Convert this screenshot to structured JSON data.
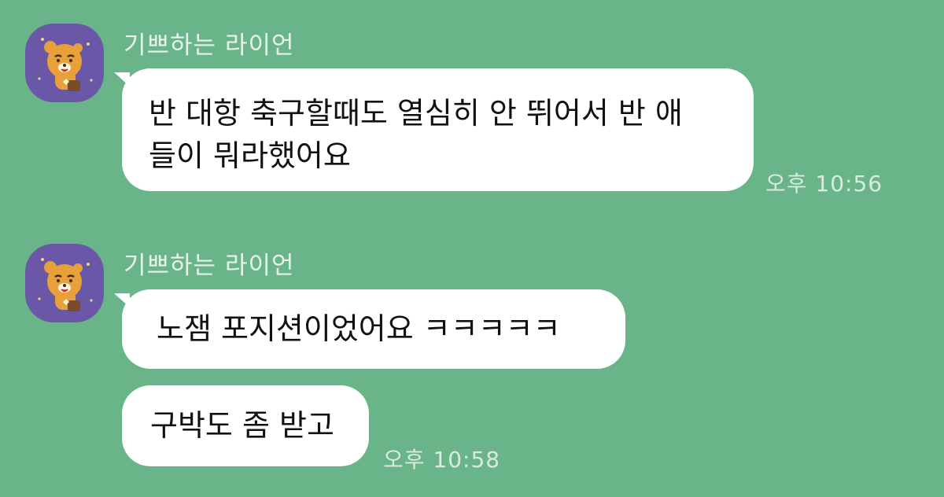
{
  "chat": {
    "messages": [
      {
        "sender": "기쁘하는 라이언",
        "lines": [
          "반 대항 축구할때도 열심히 안 뛰어서 반 애",
          "들이 뭐라했어요"
        ],
        "time": "오후 10:56"
      },
      {
        "sender": "기쁘하는 라이언",
        "lines": [
          "노잼 포지션이었어요 ㅋㅋㅋㅋㅋ"
        ],
        "time": ""
      },
      {
        "sender": "",
        "lines": [
          "구박도 좀 받고"
        ],
        "time": "오후 10:58"
      }
    ]
  },
  "colors": {
    "background": "#6ab489",
    "bubble": "#ffffff",
    "avatar_bg": "#6a57a8"
  },
  "icons": {
    "avatar": "ryan-character-icon"
  }
}
